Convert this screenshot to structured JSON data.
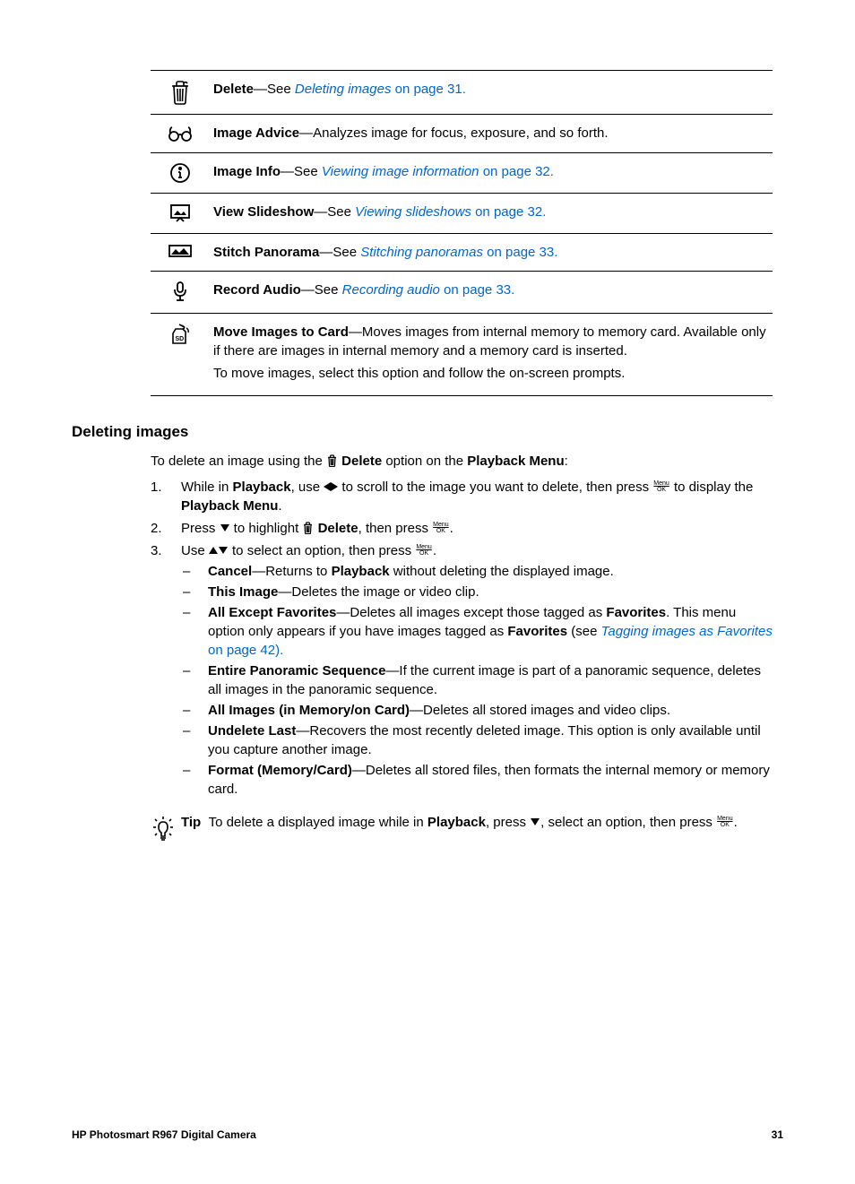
{
  "rows": [
    {
      "label": "Delete",
      "sep": "—See ",
      "link": "Deleting images",
      "after": " on page 31."
    },
    {
      "label": "Image Advice",
      "sep": "—Analyzes image for focus, exposure, and so forth."
    },
    {
      "label": "Image Info",
      "sep": "—See ",
      "link": "Viewing image information",
      "after": " on page 32."
    },
    {
      "label": "View Slideshow",
      "sep": "—See ",
      "link": "Viewing slideshows",
      "after": " on page 32."
    },
    {
      "label": "Stitch Panorama",
      "sep": "—See ",
      "link": "Stitching panoramas",
      "after": " on page 33."
    },
    {
      "label": "Record Audio",
      "sep": "—See ",
      "link": "Recording audio",
      "after": " on page 33."
    },
    {
      "label": "Move Images to Card",
      "sep": "—Moves images from internal memory to memory card. Available only if there are images in internal memory and a memory card is inserted.",
      "extra": "To move images, select this option and follow the on-screen prompts."
    }
  ],
  "heading": "Deleting images",
  "intro_pre": "To delete an image using the ",
  "intro_bold1": "Delete",
  "intro_mid": " option on the ",
  "intro_bold2": "Playback Menu",
  "intro_end": ":",
  "step1_a": "While in ",
  "step1_b": "Playback",
  "step1_c": ", use ",
  "step1_d": " to scroll to the image you want to delete, then press ",
  "step1_e": " to display the ",
  "step1_f": "Playback Menu",
  "step1_g": ".",
  "step2_a": "Press ",
  "step2_b": " to highlight ",
  "step2_c": "Delete",
  "step2_d": ", then press ",
  "step2_e": ".",
  "step3_a": "Use ",
  "step3_b": " to select an option, then press ",
  "step3_c": ".",
  "opts": [
    {
      "b": "Cancel",
      "t": "—Returns to ",
      "b2": "Playback",
      "t2": " without deleting the displayed image."
    },
    {
      "b": "This Image",
      "t": "—Deletes the image or video clip."
    },
    {
      "b": "All Except Favorites",
      "t": "—Deletes all images except those tagged as ",
      "b2": "Favorites",
      "t2": ". This menu option only appears if you have images tagged as ",
      "b3": "Favorites",
      "t3": " (see ",
      "link": "Tagging images as Favorites",
      "after": " on page 42)."
    },
    {
      "b": "Entire Panoramic Sequence",
      "t": "—If the current image is part of a panoramic sequence, deletes all images in the panoramic sequence."
    },
    {
      "b": "All Images (in Memory/on Card)",
      "t": "—Deletes all stored images and video clips."
    },
    {
      "b": "Undelete Last",
      "t": "—Recovers the most recently deleted image. This option is only available until you capture another image."
    },
    {
      "b": "Format (Memory/Card)",
      "t": "—Deletes all stored files, then formats the internal memory or memory card."
    }
  ],
  "tip_label": "Tip",
  "tip_a": "To delete a displayed image while in ",
  "tip_b": "Playback",
  "tip_c": ", press ",
  "tip_d": ", select an option, then press ",
  "tip_e": ".",
  "footer_left": "HP Photosmart R967 Digital Camera",
  "footer_right": "31"
}
